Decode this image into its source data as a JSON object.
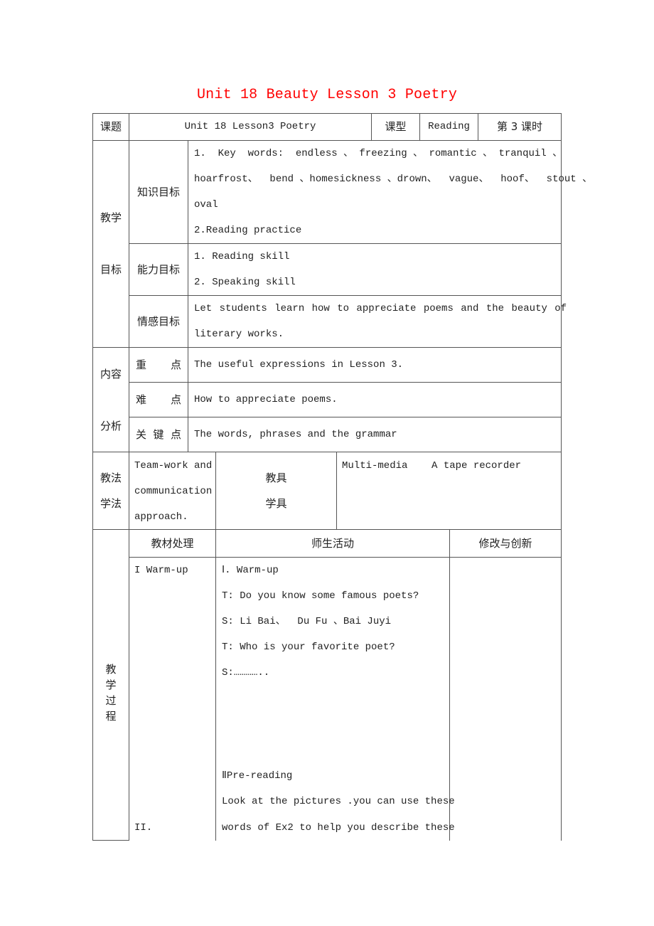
{
  "title": "Unit 18 Beauty Lesson 3 Poetry",
  "header_row": {
    "topic_label": "课题",
    "topic_value": "Unit 18 Lesson3 Poetry",
    "type_label": "课型",
    "type_value": "Reading",
    "period": "第 3 课时"
  },
  "objectives": {
    "section_label_1": "教学",
    "section_label_2": "目标",
    "knowledge": {
      "label": "知识目标",
      "lines": [
        "1.  Key  words:  endless 、 freezing 、 romantic 、 tranquil 、",
        "hoarfrost、  bend 、homesickness 、drown、  vague、  hoof、  stout 、",
        "oval",
        "2.Reading practice"
      ]
    },
    "ability": {
      "label": "能力目标",
      "lines": [
        "1. Reading skill",
        "2. Speaking skill"
      ]
    },
    "emotion": {
      "label": "情感目标",
      "lines": [
        "Let students learn how to appreciate poems and the beauty of",
        "literary works."
      ]
    }
  },
  "content_analysis": {
    "section_label_1": "内容",
    "section_label_2": "分析",
    "rows": [
      {
        "label_a": "重",
        "label_b": "",
        "label_c": "点",
        "value": "The useful expressions in Lesson 3."
      },
      {
        "label_a": "难",
        "label_b": "",
        "label_c": "点",
        "value": "How to appreciate poems."
      },
      {
        "label_a": "关",
        "label_b": "键",
        "label_c": "点",
        "value": "The words, phrases and the grammar"
      }
    ]
  },
  "methods": {
    "section_label_1": "教法",
    "section_label_2": "学法",
    "method_lines": [
      "Team-work and",
      "communication",
      "approach."
    ],
    "tools_label_1": "教具",
    "tools_label_2": "学具",
    "tools_value": "Multi-media    A tape recorder"
  },
  "process": {
    "section_label": [
      "教",
      "学",
      "过",
      "程"
    ],
    "headers": {
      "material": "教材处理",
      "activity": "师生活动",
      "revision": "修改与创新"
    },
    "material_items": [
      "I Warm-up",
      "II."
    ],
    "activity_lines": [
      "Ⅰ. Warm-up",
      "T: Do you know some famous poets?",
      "S: Li Bai、  Du Fu 、Bai Juyi",
      "T: Who is your favorite poet?",
      "S:…………..",
      "ⅡPre-reading",
      "Look at the pictures .you can use these",
      "words of Ex2 to help you describe these"
    ]
  }
}
